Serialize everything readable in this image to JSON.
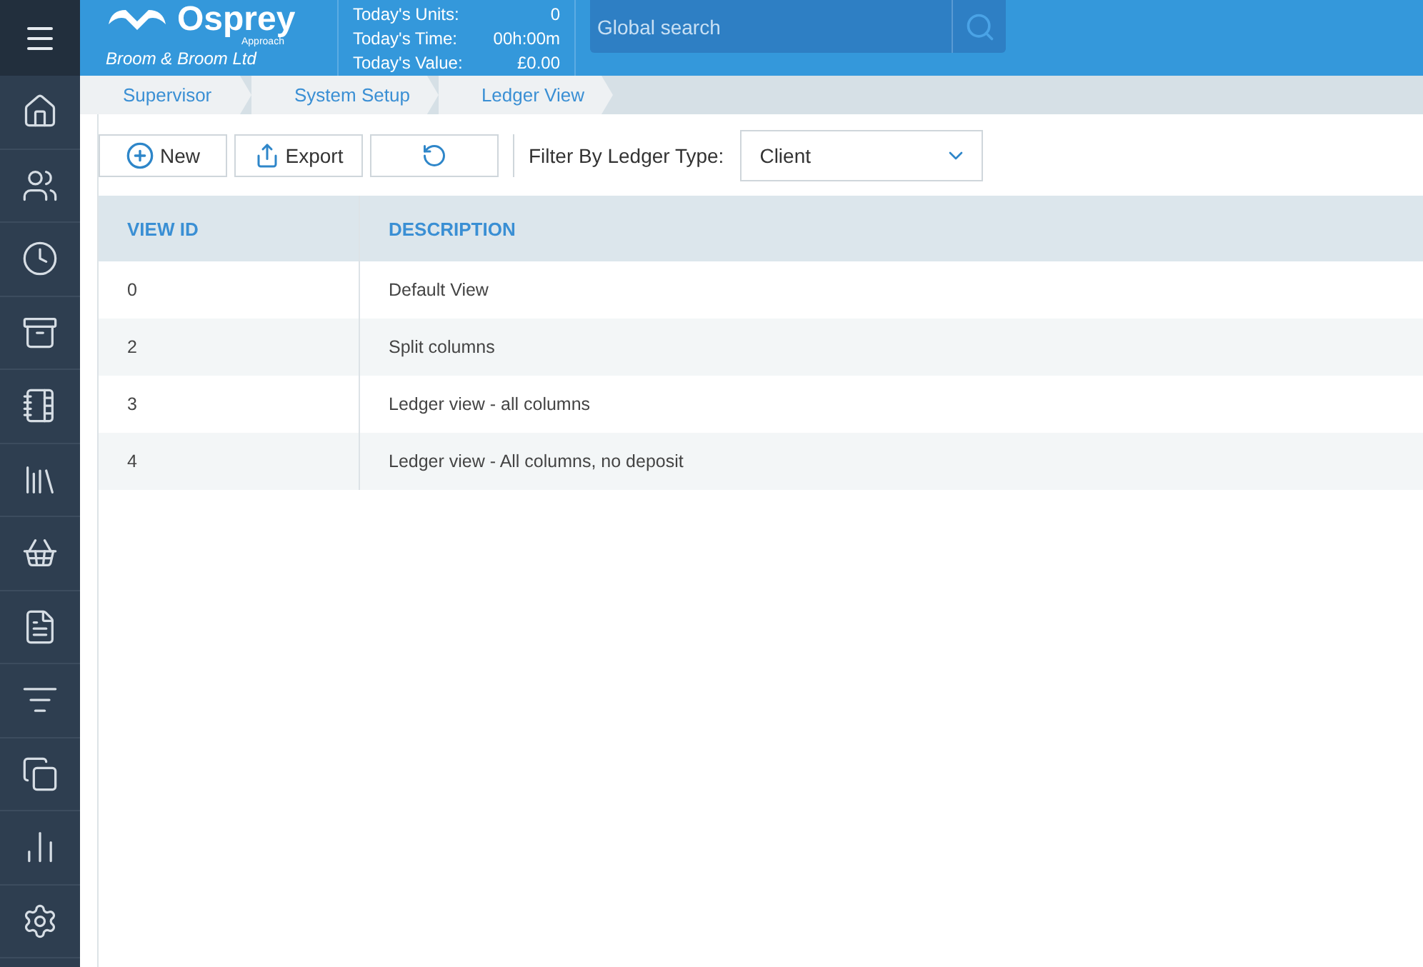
{
  "brand": {
    "name": "Osprey",
    "tagline": "Approach",
    "company": "Broom & Broom Ltd"
  },
  "stats": [
    {
      "label": "Today's Units:",
      "value": "0"
    },
    {
      "label": "Today's Time:",
      "value": "00h:00m"
    },
    {
      "label": "Today's Value:",
      "value": "£0.00"
    }
  ],
  "search": {
    "placeholder": "Global search"
  },
  "breadcrumbs": [
    "Supervisor",
    "System Setup",
    "Ledger View"
  ],
  "toolbar": {
    "buttons": [
      {
        "kind": "new",
        "label": "New"
      },
      {
        "kind": "export",
        "label": "Export"
      },
      {
        "kind": "refresh"
      }
    ],
    "filter_label": "Filter By Ledger Type:",
    "filter_value": "Client"
  },
  "table": {
    "columns": [
      "VIEW ID",
      "DESCRIPTION"
    ],
    "rows": [
      [
        "0",
        "Default View"
      ],
      [
        "2",
        "Split columns"
      ],
      [
        "3",
        "Ledger view - all columns"
      ],
      [
        "4",
        "Ledger view - All columns, no deposit"
      ]
    ]
  }
}
